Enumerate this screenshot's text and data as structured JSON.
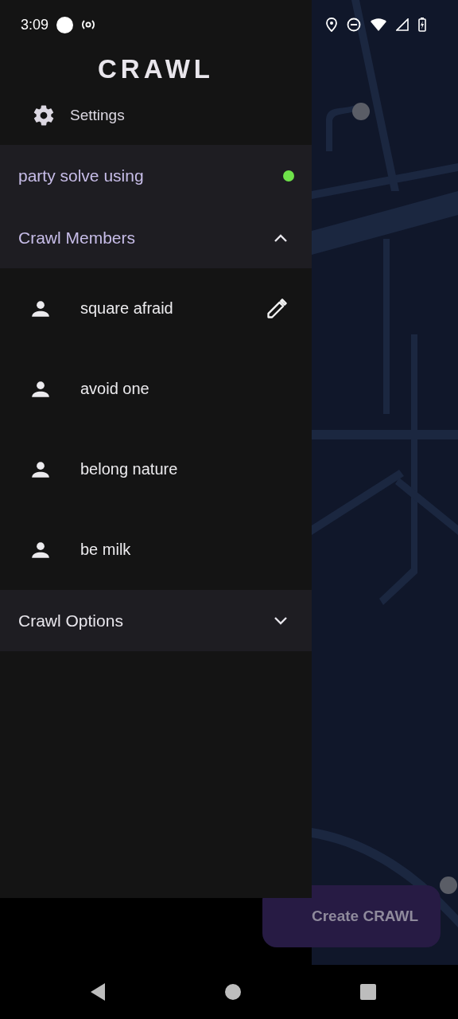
{
  "status_bar": {
    "time": "3:09"
  },
  "app_title": "CRAWL",
  "settings": {
    "label": "Settings"
  },
  "party": {
    "name": "party solve using",
    "color": "#6fe24a"
  },
  "sections": [
    {
      "title": "Crawl Members",
      "expanded": true,
      "members": [
        {
          "name": "square afraid",
          "editable": true
        },
        {
          "name": "avoid one",
          "editable": false
        },
        {
          "name": "belong nature",
          "editable": false
        },
        {
          "name": "be milk",
          "editable": false
        }
      ]
    },
    {
      "title": "Crawl Options",
      "expanded": false
    }
  ],
  "create_button": {
    "label": "Create CRAWL"
  }
}
